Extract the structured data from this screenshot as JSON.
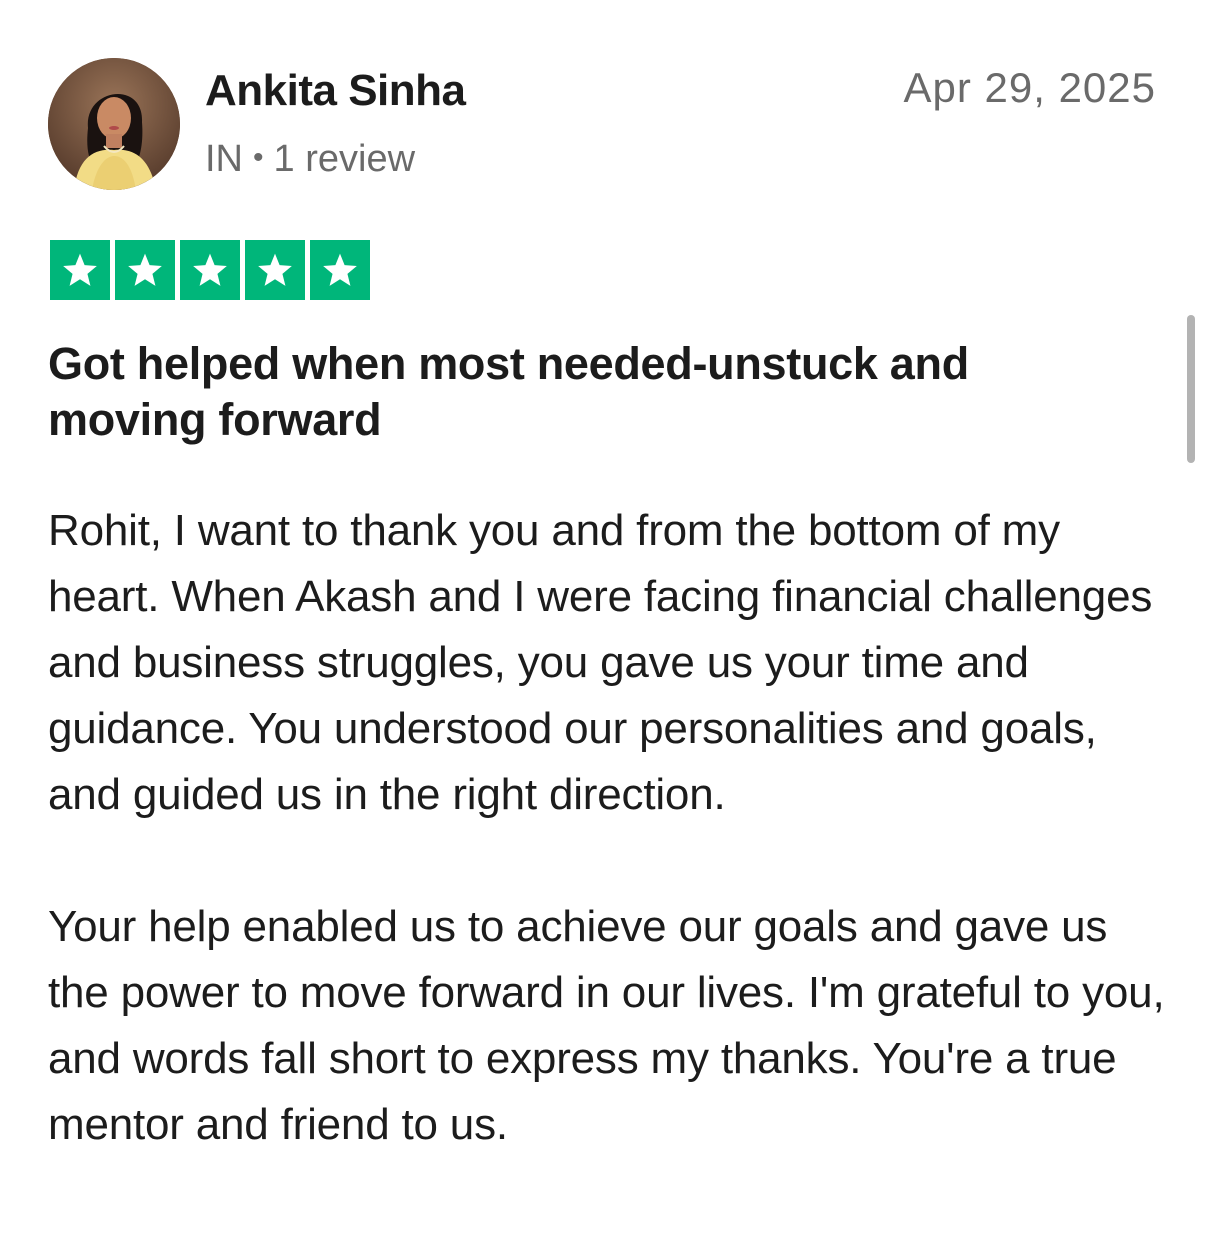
{
  "reviewer": {
    "name": "Ankita Sinha",
    "country": "IN",
    "separator": "•",
    "review_count": "1 review",
    "avatar_icon": "user-photo-avatar"
  },
  "review": {
    "date": "Apr 29, 2025",
    "rating": 5,
    "rating_max": 5,
    "star_color": "#00b67a",
    "title": "Got helped when most needed-unstuck and moving forward",
    "paragraphs": [
      "Rohit, I want to thank you and from the bottom of my heart. When Akash and I were facing financial challenges and business struggles, you gave us your time and guidance. You understood our personalities and goals, and guided us in the right direction.",
      "Your help enabled us to achieve our goals and gave us the power to move forward in our lives. I'm grateful to you, and words fall short to express my thanks. You're a true mentor and friend to us."
    ]
  }
}
